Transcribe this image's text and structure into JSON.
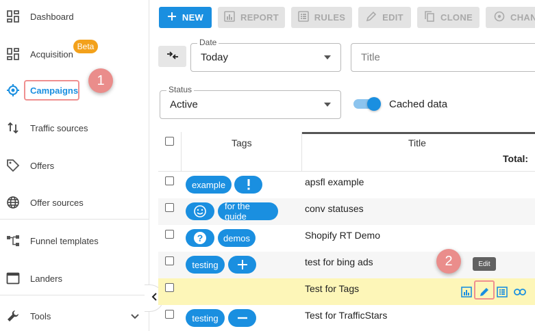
{
  "sidebar": {
    "items": [
      {
        "label": "Dashboard",
        "icon": "dashboard-icon"
      },
      {
        "label": "Acquisition",
        "icon": "acquisition-icon",
        "badge": "Beta"
      },
      {
        "label": "Campaigns",
        "icon": "target-icon",
        "active": true
      },
      {
        "label": "Traffic sources",
        "icon": "arrows-updown-icon"
      },
      {
        "label": "Offers",
        "icon": "tag-icon"
      },
      {
        "label": "Offer sources",
        "icon": "globe-icon"
      },
      {
        "label": "Funnel templates",
        "icon": "funnel-icon"
      },
      {
        "label": "Landers",
        "icon": "window-icon"
      },
      {
        "label": "Tools",
        "icon": "wrench-icon"
      }
    ]
  },
  "callouts": {
    "step1": "1",
    "step2": "2"
  },
  "toolbar": {
    "new_label": "NEW",
    "report_label": "REPORT",
    "rules_label": "RULES",
    "edit_label": "EDIT",
    "clone_label": "CLONE",
    "change_label": "CHAN"
  },
  "filters": {
    "date_label": "Date",
    "date_value": "Today",
    "title_placeholder": "Title",
    "status_label": "Status",
    "status_value": "Active",
    "cached_label": "Cached data",
    "cached_on": true
  },
  "table": {
    "headers": {
      "tags": "Tags",
      "title": "Title",
      "total": "Total:"
    },
    "rows": [
      {
        "title": "apsfl example",
        "tags": [
          "example",
          "!"
        ]
      },
      {
        "title": "conv statuses",
        "tags": [
          "☺",
          "for the guide"
        ]
      },
      {
        "title": "Shopify RT Demo",
        "tags": [
          "?",
          "demos"
        ]
      },
      {
        "title": "test for bing ads",
        "tags": [
          "testing",
          "+"
        ]
      },
      {
        "title": "Test for Tags",
        "tags": [],
        "highlighted": true
      },
      {
        "title": "Test for TrafficStars",
        "tags": [
          "testing",
          "−"
        ]
      }
    ]
  },
  "tooltip": {
    "edit": "Edit"
  },
  "colors": {
    "accent": "#1a8fe0",
    "beta": "#f3a11b",
    "callout": "#ea8d8b",
    "highlight_row": "#fdf6b8"
  }
}
